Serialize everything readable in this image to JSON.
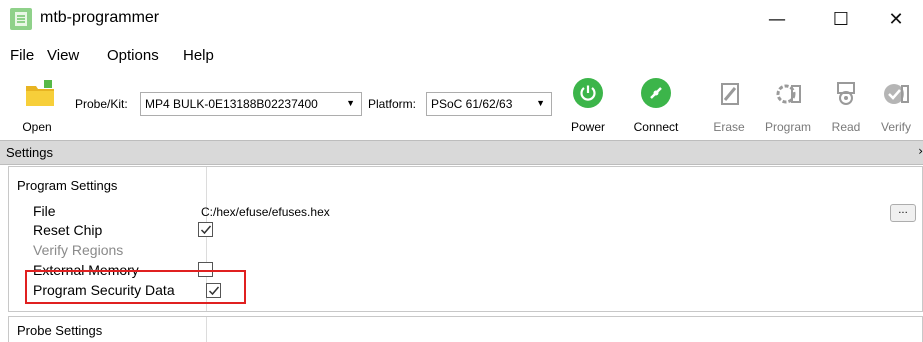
{
  "window": {
    "title": "mtb-programmer",
    "minimize": "—",
    "maximize": "☐",
    "close": "✕"
  },
  "menu": {
    "file": "File",
    "view": "View",
    "options": "Options",
    "help": "Help"
  },
  "toolbar": {
    "open_label": "Open",
    "probe_label": "Probe/Kit:",
    "probe_value": "MP4 BULK-0E13188B02237400",
    "platform_label": "Platform:",
    "platform_value": "PSoC 61/62/63",
    "power_label": "Power",
    "connect_label": "Connect",
    "erase_label": "Erase",
    "program_label": "Program",
    "read_label": "Read",
    "verify_label": "Verify",
    "colors": {
      "power": "#3cb54a",
      "connect": "#3cb54a",
      "open_folder": "#f4c430",
      "disabled_icon": "#b5b5b5"
    }
  },
  "settings": {
    "header": "Settings",
    "collapse": "›"
  },
  "program_settings": {
    "title": "Program Settings",
    "file_label": "File",
    "file_value": "C:/hex/efuse/efuses.hex",
    "browse_label": "...",
    "reset_chip_label": "Reset Chip",
    "reset_chip_checked": true,
    "verify_regions_label": "Verify Regions",
    "external_memory_label": "External Memory",
    "external_memory_checked": false,
    "program_security_label": "Program Security Data",
    "program_security_checked": true
  },
  "probe_settings": {
    "title": "Probe Settings"
  }
}
